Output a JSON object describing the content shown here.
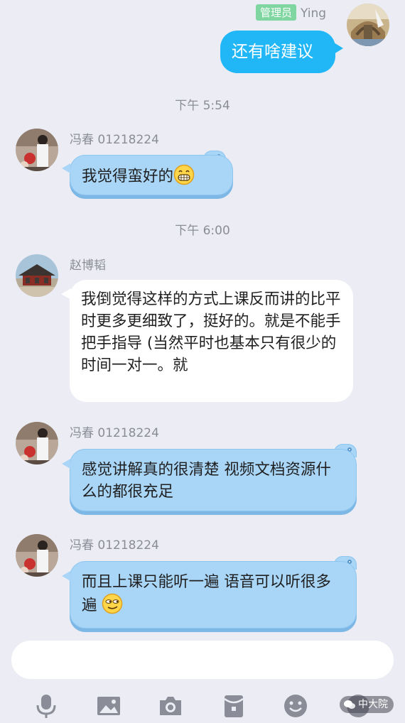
{
  "conversation": {
    "own_message": {
      "role_badge": "管理员",
      "sender": "Ying",
      "text": "还有啥建议"
    },
    "time_1": "下午 5:54",
    "message_1": {
      "sender": "冯春 01218224",
      "text": "我觉得蛮好的"
    },
    "time_2": "下午 6:00",
    "message_2": {
      "sender": "赵博韬",
      "text": "我倒觉得这样的方式上课反而讲的比平时更多更细致了，挺好的。就是不能手把手指导 (当然平时也基本只有很少的时间一对一。就"
    },
    "message_3": {
      "sender": "冯春 01218224",
      "text": "感觉讲解真的很清楚 视频文档资源什么的都很充足"
    },
    "message_4": {
      "sender": "冯春 01218224",
      "text": "而且上课只能听一遍 语音可以听很多遍"
    }
  },
  "composer": {
    "value": "",
    "placeholder": ""
  },
  "toolbar": {
    "icons": [
      "microphone-icon",
      "image-icon",
      "camera-icon",
      "red-packet-icon",
      "emoji-icon"
    ]
  },
  "watermark": {
    "text": "中大院"
  },
  "colors": {
    "background": "#ecedf4",
    "own_bubble": "#21b7f6",
    "blue_bubble": "#a9d5f7",
    "badge": "#7fd6a0"
  }
}
